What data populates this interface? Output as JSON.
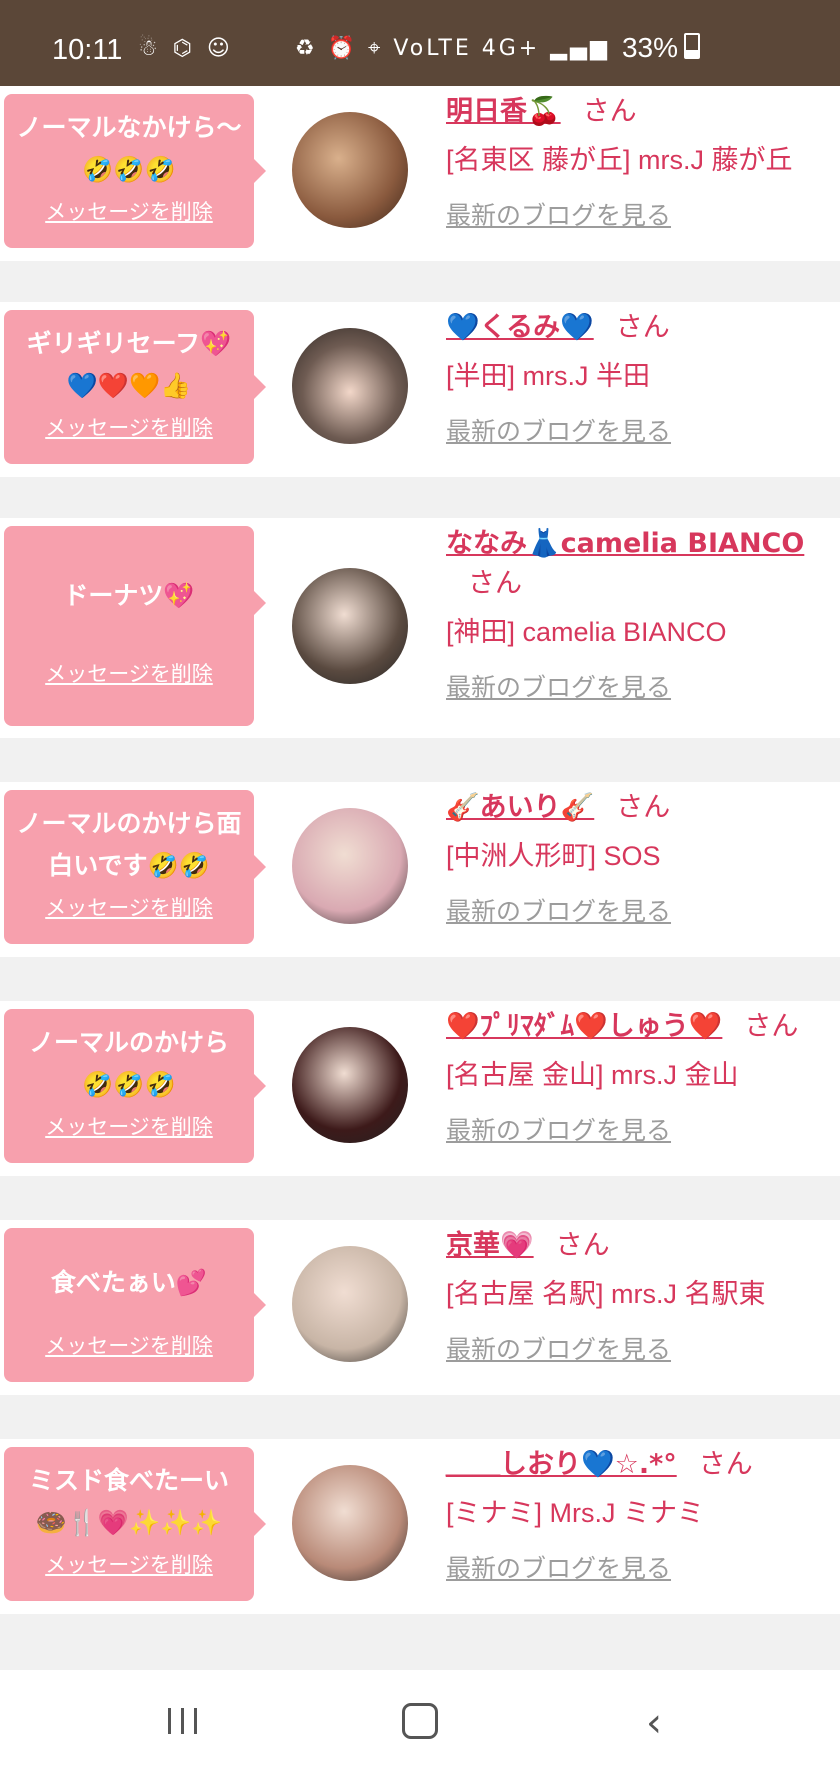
{
  "status_bar": {
    "time": "10:11",
    "left_icons": "☃ ⌬ ☺",
    "right_icons": "♻ ⏰ ⌖ VoLTE 4G+ ▂▄▆",
    "battery": "33%"
  },
  "messages": [
    {
      "bubble_text": "ノーマルなかけら〜🤣🤣🤣",
      "delete_label": "メッセージを削除",
      "name": "明日香🍒",
      "san": "さん",
      "shop": "[名東区 藤が丘] mrs.J 藤が丘",
      "blog_link": "最新のブログを見る",
      "avatar_color": "#8a5a3e"
    },
    {
      "bubble_text": "ギリギリセーフ💖💙❤️🧡👍",
      "delete_label": "メッセージを削除",
      "name": "💙くるみ💙",
      "san": "さん",
      "shop": "[半田] mrs.J 半田",
      "blog_link": "最新のブログを見る",
      "avatar_color": "#6e5b52"
    },
    {
      "bubble_text": "ドーナツ💖",
      "delete_label": "メッセージを削除",
      "name": "ななみ👗camelia BIANCO",
      "san": "さん",
      "shop": "[神田] camelia BIANCO",
      "blog_link": "最新のブログを見る",
      "avatar_color": "#5a4a40"
    },
    {
      "bubble_text": "ノーマルのかけら面白いです🤣🤣",
      "delete_label": "メッセージを削除",
      "name": "🎸あいり🎸",
      "san": "さん",
      "shop": "[中洲人形町] SOS",
      "blog_link": "最新のブログを見る",
      "avatar_color": "#d9a9b2"
    },
    {
      "bubble_text": "ノーマルのかけら🤣🤣🤣",
      "delete_label": "メッセージを削除",
      "name": "❤️ﾌﾟﾘﾏﾀﾞﾑ❤️しゅう❤️",
      "san": "さん",
      "shop": "[名古屋 金山] mrs.J 金山",
      "blog_link": "最新のブログを見る",
      "avatar_color": "#3d1a1a"
    },
    {
      "bubble_text": "食べたぁい💕",
      "delete_label": "メッセージを削除",
      "name": "京華💗",
      "san": "さん",
      "shop": "[名古屋 名駅] mrs.J 名駅東",
      "blog_link": "最新のブログを見る",
      "avatar_color": "#c8b5a6"
    },
    {
      "bubble_text": "ミスド食べたーい🍩🍴💗✨✨✨",
      "delete_label": "メッセージを削除",
      "name": "＿＿しおり💙☆.*°",
      "san": "さん",
      "shop": "[ミナミ] Mrs.J ミナミ",
      "blog_link": "最新のブログを見る",
      "avatar_color": "#b98a78"
    }
  ]
}
